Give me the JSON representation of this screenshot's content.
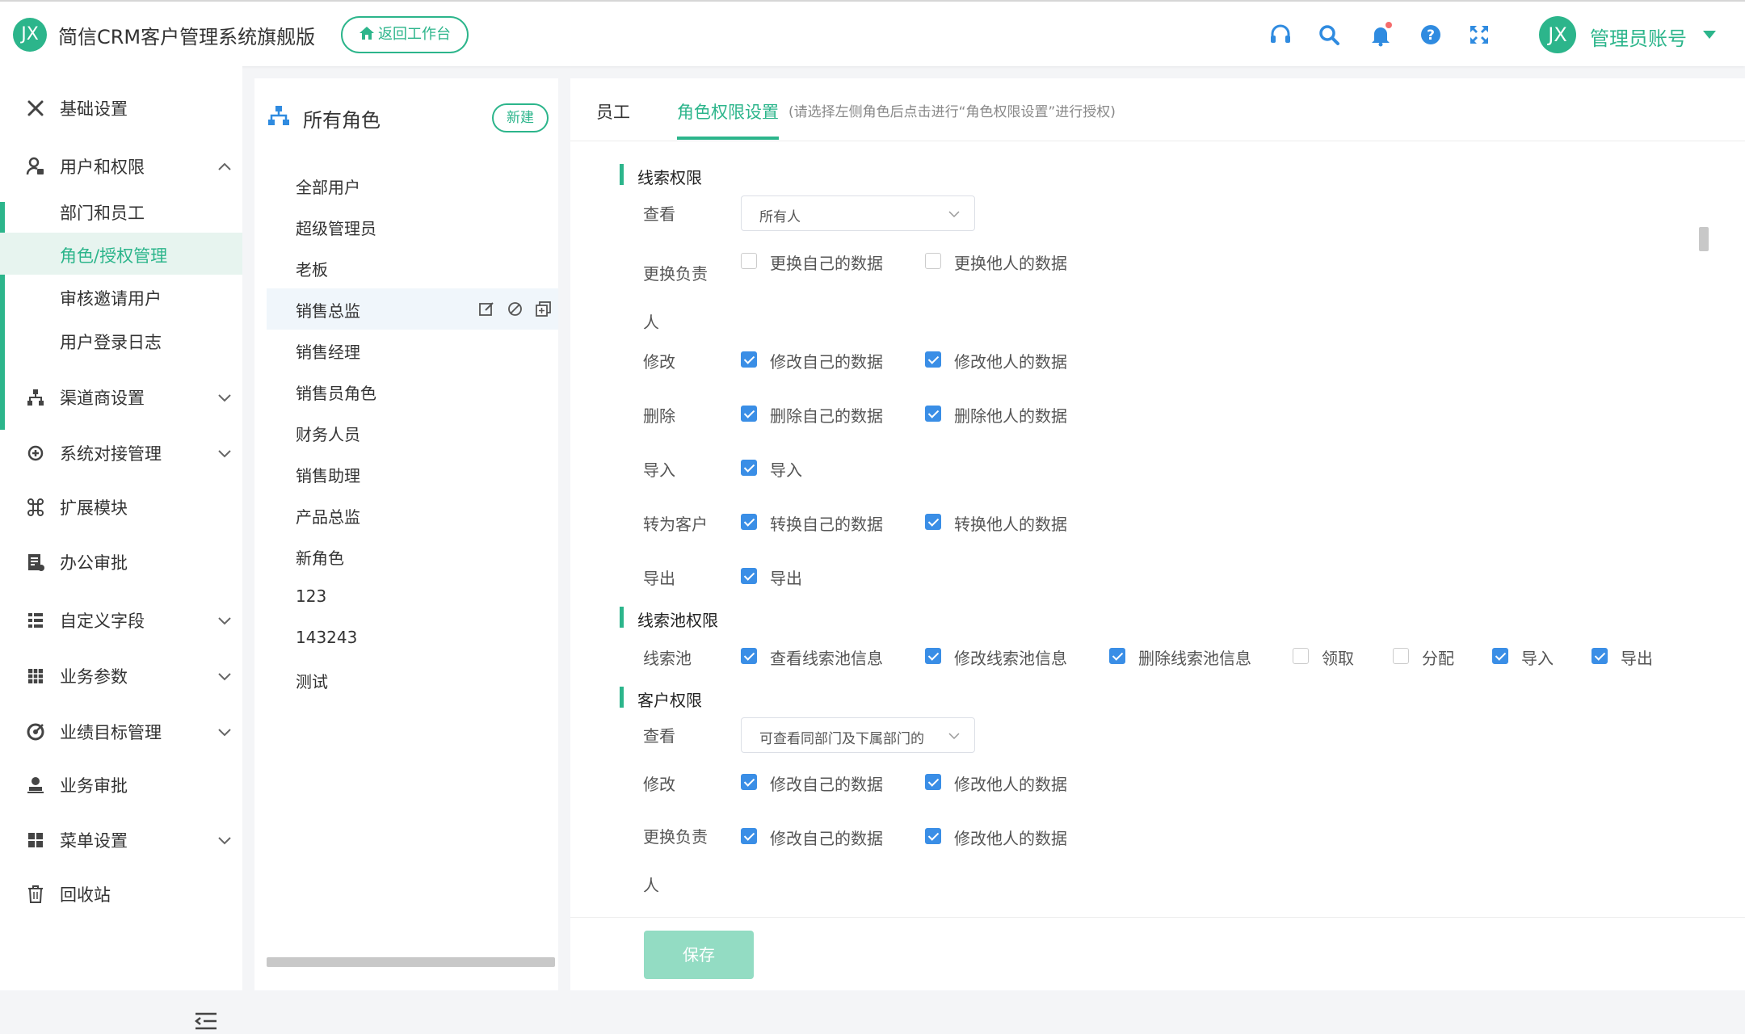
{
  "app": {
    "logo_text": "JX",
    "title": "简信CRM客户管理系统旗舰版",
    "back_button": "返回工作台",
    "user_avatar": "JX",
    "user_name": "管理员账号",
    "accent_color": "#2cb58b"
  },
  "sidebar": {
    "items": [
      {
        "label": "基础设置",
        "icon": "wrench-icon"
      },
      {
        "label": "用户和权限",
        "icon": "user-lock-icon",
        "expanded": true
      },
      {
        "label": "渠道商设置",
        "icon": "org-chart-icon"
      },
      {
        "label": "系统对接管理",
        "icon": "plug-icon"
      },
      {
        "label": "扩展模块",
        "icon": "command-icon"
      },
      {
        "label": "办公审批",
        "icon": "doc-approve-icon"
      },
      {
        "label": "自定义字段",
        "icon": "list-icon"
      },
      {
        "label": "业务参数",
        "icon": "grid-icon"
      },
      {
        "label": "业绩目标管理",
        "icon": "target-icon"
      },
      {
        "label": "业务审批",
        "icon": "stamp-icon"
      },
      {
        "label": "菜单设置",
        "icon": "menu-blocks-icon"
      },
      {
        "label": "回收站",
        "icon": "trash-icon"
      }
    ],
    "sub_items": [
      {
        "label": "部门和员工"
      },
      {
        "label": "角色/授权管理",
        "active": true
      },
      {
        "label": "审核邀请用户"
      },
      {
        "label": "用户登录日志"
      }
    ]
  },
  "roles": {
    "title": "所有角色",
    "new_button": "新建",
    "items": [
      "全部用户",
      "超级管理员",
      "老板",
      "销售总监",
      "销售经理",
      "销售员角色",
      "财务人员",
      "销售助理",
      "产品总监",
      "新角色",
      "123",
      "143243",
      "测试"
    ],
    "active_index": 3
  },
  "main": {
    "tabs": [
      {
        "label": "员工"
      },
      {
        "label": "角色权限设置",
        "active": true
      }
    ],
    "tab_hint": "(请选择左侧角色后点击进行“角色权限设置”进行授权)",
    "sections": {
      "lead": {
        "title": "线索权限",
        "view_label": "查看",
        "view_value": "所有人",
        "change_owner_label": "更换负责人",
        "change_own": "更换自己的数据",
        "change_others": "更换他人的数据",
        "edit_label": "修改",
        "edit_own": "修改自己的数据",
        "edit_others": "修改他人的数据",
        "delete_label": "删除",
        "delete_own": "删除自己的数据",
        "delete_others": "删除他人的数据",
        "import_label": "导入",
        "import_opt": "导入",
        "convert_label": "转为客户",
        "convert_own": "转换自己的数据",
        "convert_others": "转换他人的数据",
        "export_label": "导出",
        "export_opt": "导出"
      },
      "pool": {
        "title": "线索池权限",
        "row_label": "线索池",
        "options": [
          "查看线索池信息",
          "修改线索池信息",
          "删除线索池信息",
          "领取",
          "分配",
          "导入",
          "导出"
        ],
        "checked": [
          true,
          true,
          true,
          false,
          false,
          true,
          true
        ]
      },
      "customer": {
        "title": "客户权限",
        "view_label": "查看",
        "view_value": "可查看同部门及下属部门的",
        "edit_label": "修改",
        "edit_own": "修改自己的数据",
        "edit_others": "修改他人的数据",
        "change_owner_label": "更换负责人",
        "change_own": "修改自己的数据",
        "change_others": "修改他人的数据"
      }
    },
    "save_button": "保存"
  }
}
